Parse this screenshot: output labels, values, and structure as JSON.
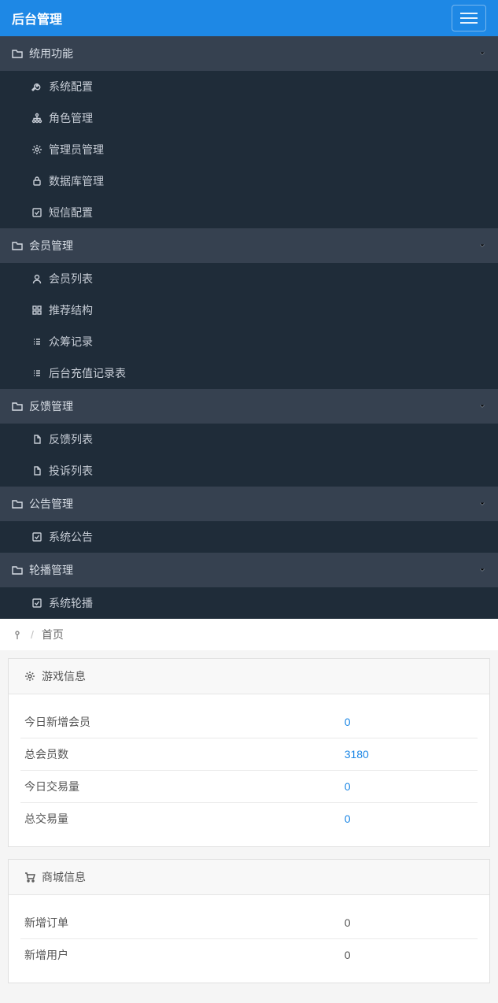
{
  "header": {
    "title": "后台管理"
  },
  "nav": [
    {
      "label": "统用功能",
      "items": [
        {
          "icon": "wrench",
          "label": "系统配置"
        },
        {
          "icon": "sitemap",
          "label": "角色管理"
        },
        {
          "icon": "gear",
          "label": "管理员管理"
        },
        {
          "icon": "lock",
          "label": "数据库管理"
        },
        {
          "icon": "check-square",
          "label": "短信配置"
        }
      ]
    },
    {
      "label": "会员管理",
      "items": [
        {
          "icon": "user",
          "label": "会员列表"
        },
        {
          "icon": "grid",
          "label": "推荐结构"
        },
        {
          "icon": "list",
          "label": "众筹记录"
        },
        {
          "icon": "list",
          "label": "后台充值记录表"
        }
      ]
    },
    {
      "label": "反馈管理",
      "items": [
        {
          "icon": "file",
          "label": "反馈列表"
        },
        {
          "icon": "file",
          "label": "投诉列表"
        }
      ]
    },
    {
      "label": "公告管理",
      "items": [
        {
          "icon": "check-square",
          "label": "系统公告"
        }
      ]
    },
    {
      "label": "轮播管理",
      "items": [
        {
          "icon": "check-square",
          "label": "系统轮播"
        }
      ]
    }
  ],
  "breadcrumb": {
    "current": "首页"
  },
  "panels": [
    {
      "icon": "gear",
      "title": "游戏信息",
      "value_class": "value",
      "rows": [
        {
          "label": "今日新增会员",
          "value": "0"
        },
        {
          "label": "总会员数",
          "value": "3180"
        },
        {
          "label": "今日交易量",
          "value": "0"
        },
        {
          "label": "总交易量",
          "value": "0"
        }
      ]
    },
    {
      "icon": "cart",
      "title": "商城信息",
      "value_class": "value-plain",
      "rows": [
        {
          "label": "新增订单",
          "value": "0"
        },
        {
          "label": "新增用户",
          "value": "0"
        }
      ]
    }
  ]
}
